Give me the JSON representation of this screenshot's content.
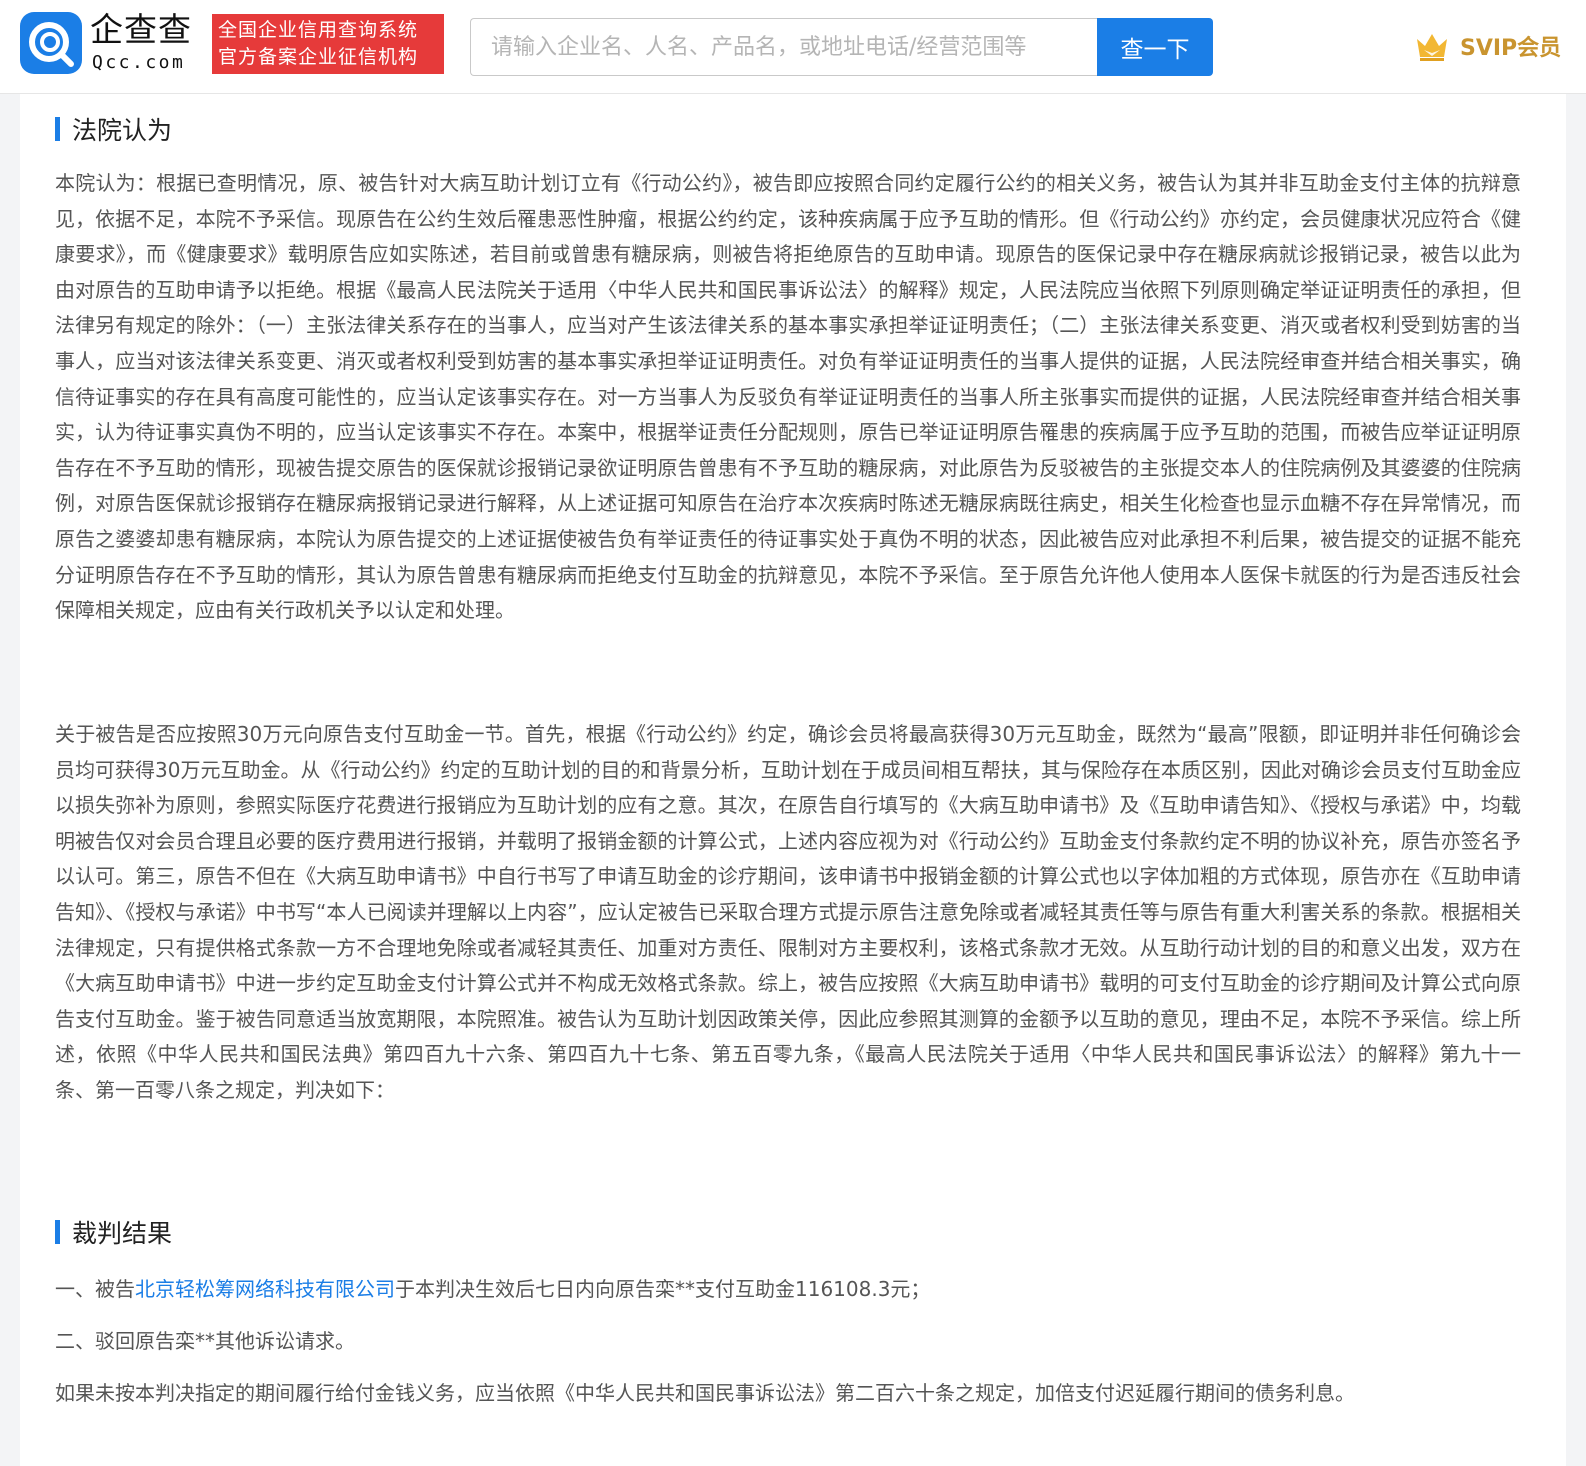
{
  "header": {
    "logo_name": "企查查",
    "logo_domain": "Qcc.com",
    "badge_line1": "全国企业信用查询系统",
    "badge_line2": "官方备案企业征信机构",
    "search_placeholder": "请输入企业名、人名、产品名，或地址电话/经营范围等",
    "search_button": "查一下",
    "svip_label": "SVIP会员",
    "accent_color": "#1b7ee6",
    "badge_color": "#e63a3a",
    "svip_color": "#c9942f"
  },
  "section1": {
    "title": "法院认为",
    "para1": "本院认为：根据已查明情况，原、被告针对大病互助计划订立有《行动公约》，被告即应按照合同约定履行公约的相关义务，被告认为其并非互助金支付主体的抗辩意见，依据不足，本院不予采信。现原告在公约生效后罹患恶性肿瘤，根据公约约定，该种疾病属于应予互助的情形。但《行动公约》亦约定，会员健康状况应符合《健康要求》，而《健康要求》载明原告应如实陈述，若目前或曾患有糖尿病，则被告将拒绝原告的互助申请。现原告的医保记录中存在糖尿病就诊报销记录，被告以此为由对原告的互助申请予以拒绝。根据《最高人民法院关于适用〈中华人民共和国民事诉讼法〉的解释》规定，人民法院应当依照下列原则确定举证证明责任的承担，但法律另有规定的除外：（一）主张法律关系存在的当事人，应当对产生该法律关系的基本事实承担举证证明责任；（二）主张法律关系变更、消灭或者权利受到妨害的当事人，应当对该法律关系变更、消灭或者权利受到妨害的基本事实承担举证证明责任。对负有举证证明责任的当事人提供的证据，人民法院经审查并结合相关事实，确信待证事实的存在具有高度可能性的，应当认定该事实存在。对一方当事人为反驳负有举证证明责任的当事人所主张事实而提供的证据，人民法院经审查并结合相关事实，认为待证事实真伪不明的，应当认定该事实不存在。本案中，根据举证责任分配规则，原告已举证证明原告罹患的疾病属于应予互助的范围，而被告应举证证明原告存在不予互助的情形，现被告提交原告的医保就诊报销记录欲证明原告曾患有不予互助的糖尿病，对此原告为反驳被告的主张提交本人的住院病例及其婆婆的住院病例，对原告医保就诊报销存在糖尿病报销记录进行解释，从上述证据可知原告在治疗本次疾病时陈述无糖尿病既往病史，相关生化检查也显示血糖不存在异常情况，而原告之婆婆却患有糖尿病，本院认为原告提交的上述证据使被告负有举证责任的待证事实处于真伪不明的状态，因此被告应对此承担不利后果，被告提交的证据不能充分证明原告存在不予互助的情形，其认为原告曾患有糖尿病而拒绝支付互助金的抗辩意见，本院不予采信。至于原告允许他人使用本人医保卡就医的行为是否违反社会保障相关规定，应由有关行政机关予以认定和处理。",
    "para2": "关于被告是否应按照30万元向原告支付互助金一节。首先，根据《行动公约》约定，确诊会员将最高获得30万元互助金，既然为“最高”限额，即证明并非任何确诊会员均可获得30万元互助金。从《行动公约》约定的互助计划的目的和背景分析，互助计划在于成员间相互帮扶，其与保险存在本质区别，因此对确诊会员支付互助金应以损失弥补为原则，参照实际医疗花费进行报销应为互助计划的应有之意。其次，在原告自行填写的《大病互助申请书》及《互助申请告知》、《授权与承诺》中，均载明被告仅对会员合理且必要的医疗费用进行报销，并载明了报销金额的计算公式，上述内容应视为对《行动公约》互助金支付条款约定不明的协议补充，原告亦签名予以认可。第三，原告不但在《大病互助申请书》中自行书写了申请互助金的诊疗期间，该申请书中报销金额的计算公式也以字体加粗的方式体现，原告亦在《互助申请告知》、《授权与承诺》中书写“本人已阅读并理解以上内容”，应认定被告已采取合理方式提示原告注意免除或者减轻其责任等与原告有重大利害关系的条款。根据相关法律规定，只有提供格式条款一方不合理地免除或者减轻其责任、加重对方责任、限制对方主要权利，该格式条款才无效。从互助行动计划的目的和意义出发，双方在《大病互助申请书》中进一步约定互助金支付计算公式并不构成无效格式条款。综上，被告应按照《大病互助申请书》载明的可支付互助金的诊疗期间及计算公式向原告支付互助金。鉴于被告同意适当放宽期限，本院照准。被告认为互助计划因政策关停，因此应参照其测算的金额予以互助的意见，理由不足，本院不予采信。综上所述，依照《中华人民共和国民法典》第四百九十六条、第四百九十七条、第五百零九条，《最高人民法院关于适用〈中华人民共和国民事诉讼法〉的解释》第九十一条、第一百零八条之规定，判决如下："
  },
  "section2": {
    "title": "裁判结果",
    "item1_prefix": "一、被告",
    "item1_link": "北京轻松筹网络科技有限公司",
    "item1_suffix": "于本判决生效后七日内向原告栾**支付互助金116108.3元；",
    "item2": "二、驳回原告栾**其他诉讼请求。",
    "item3": "如果未按本判决指定的期间履行给付金钱义务，应当依照《中华人民共和国民事诉讼法》第二百六十条之规定，加倍支付迟延履行期间的债务利息。"
  }
}
